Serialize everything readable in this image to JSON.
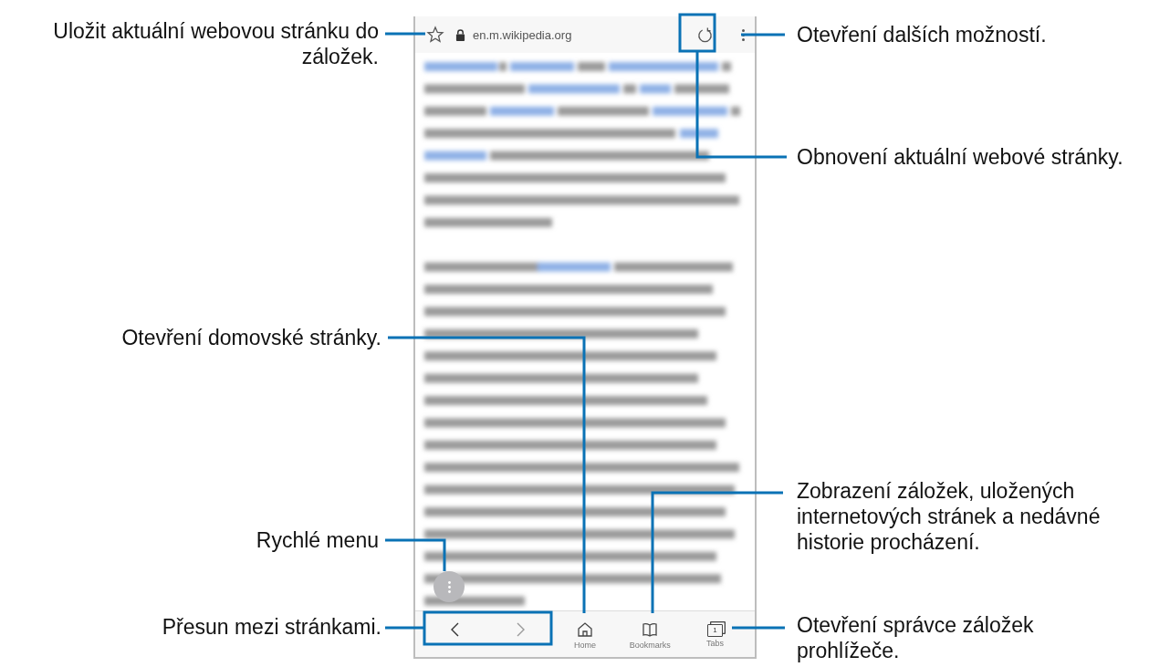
{
  "address_bar": {
    "url": "en.m.wikipedia.org"
  },
  "bottom_nav": [
    {
      "kind": "back"
    },
    {
      "kind": "forward"
    },
    {
      "kind": "home",
      "label": "Home"
    },
    {
      "kind": "bookmarks",
      "label": "Bookmarks"
    },
    {
      "kind": "tabs",
      "label": "Tabs",
      "count": "1"
    }
  ],
  "callouts": [
    {
      "text": "Uložit aktuální webovou stránku do záložek."
    },
    {
      "text": "Otevření domovské stránky."
    },
    {
      "text": "Rychlé menu"
    },
    {
      "text": "Přesun mezi stránkami."
    },
    {
      "text": "Otevření dalších možností."
    },
    {
      "text": "Obnovení aktuální webové stránky."
    },
    {
      "text": "Zobrazení záložek, uložených internetových stránek a nedávné historie procházení."
    },
    {
      "text": "Otevření správce záložek prohlížeče."
    }
  ]
}
